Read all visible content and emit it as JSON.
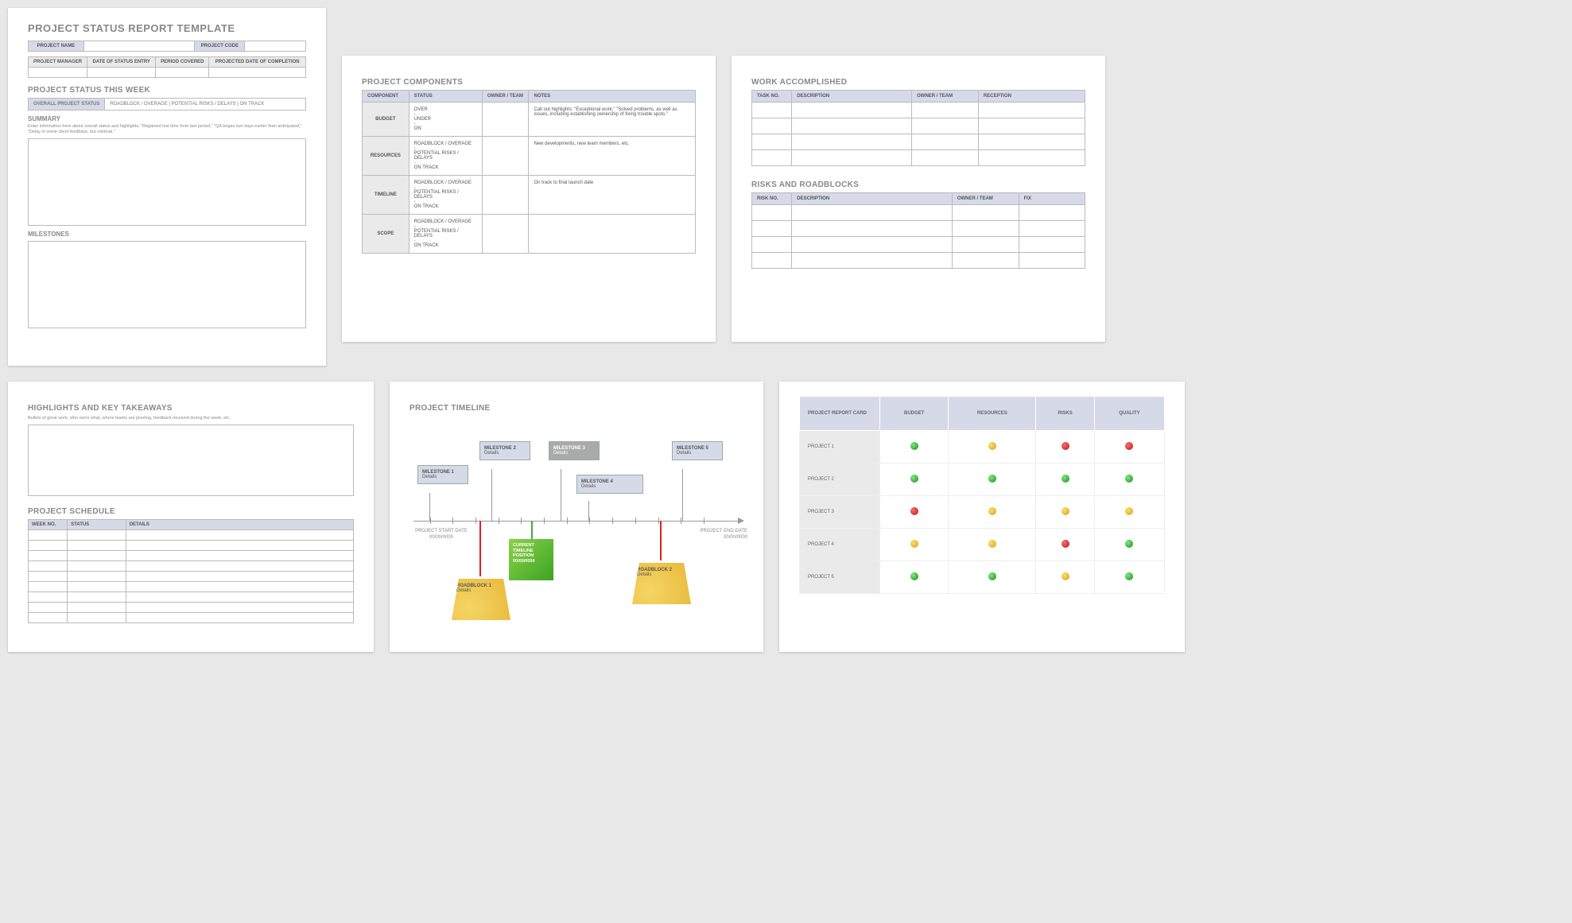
{
  "p1": {
    "title": "PROJECT STATUS REPORT TEMPLATE",
    "meta1": {
      "name_lbl": "PROJECT NAME",
      "code_lbl": "PROJECT CODE"
    },
    "meta2": {
      "c1": "PROJECT MANAGER",
      "c2": "DATE OF STATUS ENTRY",
      "c3": "PERIOD COVERED",
      "c4": "PROJECTED DATE OF COMPLETION"
    },
    "status_h": "PROJECT STATUS THIS WEEK",
    "status_row": {
      "label": "OVERALL PROJECT STATUS",
      "opts": "ROADBLOCK / OVERAGE   |   POTENTIAL RISKS / DELAYS   |   ON TRACK"
    },
    "summary_h": "SUMMARY",
    "summary_hint": "Enter information here about overall status and highlights: \"Regained lost time from last period,\" \"QA began two days earlier than anticipated,\" \"Delay in some client feedback, but minimal.\"",
    "milestones_h": "MILESTONES"
  },
  "p2": {
    "title": "PROJECT COMPONENTS",
    "headers": [
      "COMPONENT",
      "STATUS",
      "OWNER / TEAM",
      "NOTES"
    ],
    "rows": [
      {
        "comp": "BUDGET",
        "status": "OVER\n-\nUNDER\n-\nON",
        "notes": "Call out highlights: \"Exceptional work,\" \"Solved problems, as well as issues, including establishing ownership of fixing trouble spots.\""
      },
      {
        "comp": "RESOURCES",
        "status": "ROADBLOCK / OVERAGE\n-\nPOTENTIAL RISKS / DELAYS\n-\nON TRACK",
        "notes": "New developments, new team members, etc."
      },
      {
        "comp": "TIMELINE",
        "status": "ROADBLOCK / OVERAGE\n-\nPOTENTIAL RISKS / DELAYS\n-\nON TRACK",
        "notes": "On track to final launch date"
      },
      {
        "comp": "SCOPE",
        "status": "ROADBLOCK / OVERAGE\n-\nPOTENTIAL RISKS / DELAYS\n-\nON TRACK",
        "notes": ""
      }
    ]
  },
  "p3": {
    "work_h": "WORK ACCOMPLISHED",
    "work_headers": [
      "TASK NO.",
      "DESCRIPTION",
      "OWNER / TEAM",
      "RECEPTION"
    ],
    "risk_h": "RISKS AND ROADBLOCKS",
    "risk_headers": [
      "RISK NO.",
      "DESCRIPTION",
      "OWNER / TEAM",
      "FIX"
    ]
  },
  "p4": {
    "hl_h": "HIGHLIGHTS AND KEY TAKEAWAYS",
    "hl_hint": "Bullets of great work, who owns what, where teams are pivoting, feedback received during the week, etc.",
    "sched_h": "PROJECT SCHEDULE",
    "sched_headers": [
      "WEEK NO.",
      "STATUS",
      "DETAILS"
    ]
  },
  "p5": {
    "title": "PROJECT TIMELINE",
    "start": {
      "l1": "PROJECT START DATE",
      "l2": "00/00/0000"
    },
    "end": {
      "l1": "PROJECT END DATE",
      "l2": "00/00/0000"
    },
    "ms": [
      {
        "t": "MILESTONE 1",
        "d": "Details"
      },
      {
        "t": "MILESTONE 2",
        "d": "Details"
      },
      {
        "t": "MILESTONE 3",
        "d": "Details"
      },
      {
        "t": "MILESTONE 4",
        "d": "Details"
      },
      {
        "t": "MILESTONE 5",
        "d": "Details"
      }
    ],
    "current": {
      "l1": "CURRENT",
      "l2": "TIMELINE",
      "l3": "POSITION",
      "l4": "00/00/0000"
    },
    "rb": [
      {
        "t": "ROADBLOCK 1",
        "d": "Details"
      },
      {
        "t": "ROADBLOCK 2",
        "d": "Details"
      }
    ]
  },
  "p6": {
    "headers": [
      "PROJECT REPORT CARD",
      "BUDGET",
      "RESOURCES",
      "RISKS",
      "QUALITY"
    ],
    "chart_data": {
      "type": "heatmap",
      "categories": [
        "PROJECT 1",
        "PROJECT 2",
        "PROJECT 3",
        "PROJECT 4",
        "PROJECT 5"
      ],
      "columns": [
        "BUDGET",
        "RESOURCES",
        "RISKS",
        "QUALITY"
      ],
      "values": [
        [
          "g",
          "y",
          "r",
          "r"
        ],
        [
          "g",
          "g",
          "g",
          "g"
        ],
        [
          "r",
          "y",
          "y",
          "y"
        ],
        [
          "y",
          "y",
          "r",
          "g"
        ],
        [
          "g",
          "g",
          "y",
          "g"
        ]
      ],
      "legend": {
        "g": "green",
        "y": "yellow",
        "r": "red"
      }
    }
  }
}
